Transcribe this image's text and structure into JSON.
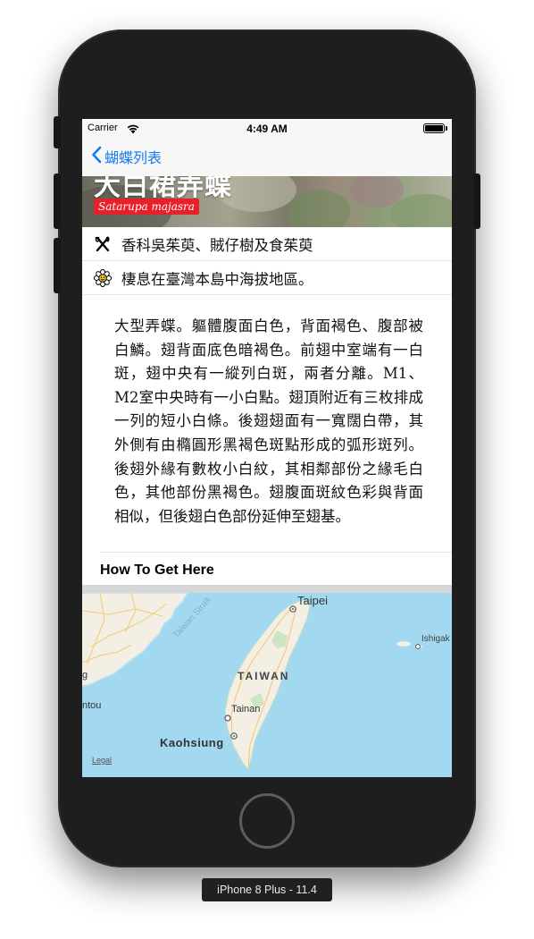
{
  "status_bar": {
    "carrier": "Carrier",
    "time": "4:49 AM"
  },
  "nav": {
    "back_label": "蝴蝶列表"
  },
  "header": {
    "title": "大白裙弄蝶",
    "scientific_name": "Satarupa majasra"
  },
  "info": {
    "food": "香科吳茱萸、賊仔樹及食茱萸",
    "habitat": "棲息在臺灣本島中海拔地區。"
  },
  "description": "大型弄蝶。軀體腹面白色，背面褐色、腹部被白鱗。翅背面底色暗褐色。前翅中室端有一白斑，翅中央有一縱列白斑，兩者分離。M1、M2室中央時有一小白點。翅頂附近有三枚排成一列的短小白條。後翅翅面有一寬闊白帶，其外側有由橢圓形黑褐色斑點形成的弧形斑列。後翅外緣有數枚小白紋，其相鄰部份之緣毛白色，其他部份黑褐色。翅腹面斑紋色彩與背面相似，但後翅白色部份延伸至翅基。",
  "section": {
    "how_to_get_here": "How To Get Here"
  },
  "map": {
    "labels": {
      "taipei": "Taipei",
      "taiwan": "TAIWAN",
      "tainan": "Tainan",
      "kaohsiung": "Kaohsiung",
      "ishigaki": "Ishigak",
      "ntou": "ntou",
      "g": "g",
      "strait": "Taiwan Strait",
      "legal": "Legal"
    }
  },
  "device": {
    "label": "iPhone 8 Plus - 11.4"
  },
  "colors": {
    "accent": "#1479f6",
    "badge": "#e8202a",
    "sea": "#a2d8f0",
    "land": "#f3efe4"
  }
}
